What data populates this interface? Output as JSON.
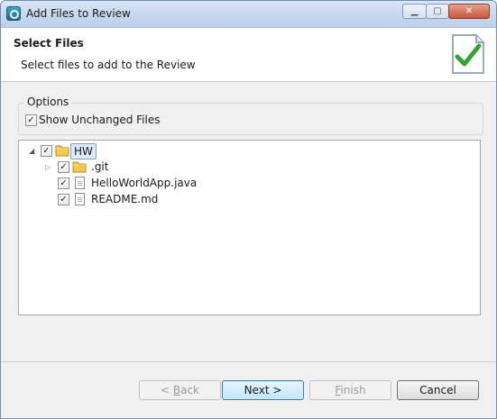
{
  "window": {
    "title": "Add Files to Review",
    "controls": {
      "minimize": "▁",
      "maximize": "▢",
      "close": "✕"
    }
  },
  "header": {
    "title": "Select Files",
    "subtitle": "Select files to add to the Review"
  },
  "options": {
    "group_label": "Options",
    "show_unchanged": {
      "label": "Show Unchanged Files",
      "checked": true
    }
  },
  "tree": {
    "root": {
      "label": "HW",
      "checked": true,
      "expanded": true,
      "icon": "folder-icon"
    },
    "children": [
      {
        "label": ".git",
        "checked": true,
        "expandable": true,
        "icon": "folder-icon"
      },
      {
        "label": "HelloWorldApp.java",
        "checked": true,
        "icon": "file-icon"
      },
      {
        "label": "README.md",
        "checked": true,
        "icon": "file-icon"
      }
    ]
  },
  "buttons": {
    "back": {
      "prefix": "< ",
      "mnemonic": "B",
      "rest": "ack",
      "enabled": false
    },
    "next": {
      "label": "Next >",
      "enabled": true,
      "default": true
    },
    "finish": {
      "mnemonic": "F",
      "rest": "inish",
      "enabled": false
    },
    "cancel": {
      "label": "Cancel",
      "enabled": true
    }
  },
  "check_glyph": "✓",
  "colors": {
    "check_green": "#2fa52f",
    "selection": "#dcebfc",
    "folder": "#f3c94a"
  }
}
